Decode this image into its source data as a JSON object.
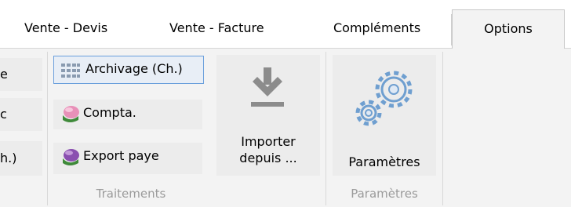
{
  "tabs": [
    {
      "label": "Vente - Devis",
      "active": false
    },
    {
      "label": "Vente - Facture",
      "active": false
    },
    {
      "label": "Compléments",
      "active": false
    },
    {
      "label": "Options",
      "active": true
    }
  ],
  "partial_buttons": [
    {
      "label": "e"
    },
    {
      "label": "c"
    },
    {
      "label": "h.)"
    }
  ],
  "traitements": {
    "items": [
      {
        "label": "Archivage (Ch.)",
        "icon": "grid-icon",
        "selected": true
      },
      {
        "label": "Compta.",
        "icon": "pink-gem-icon",
        "selected": false
      },
      {
        "label": "Export paye",
        "icon": "purple-gem-icon",
        "selected": false
      }
    ],
    "group_label": "Traitements"
  },
  "importer": {
    "line1": "Importer",
    "line2": "depuis ...",
    "icon": "download-arrow-icon"
  },
  "parametres": {
    "button_label": "Paramètres",
    "group_label": "Paramètres",
    "icon": "gears-icon"
  },
  "colors": {
    "accent": "#6a9fdc",
    "gear": "#6f9fd0",
    "arrow": "#8c8c8c"
  }
}
